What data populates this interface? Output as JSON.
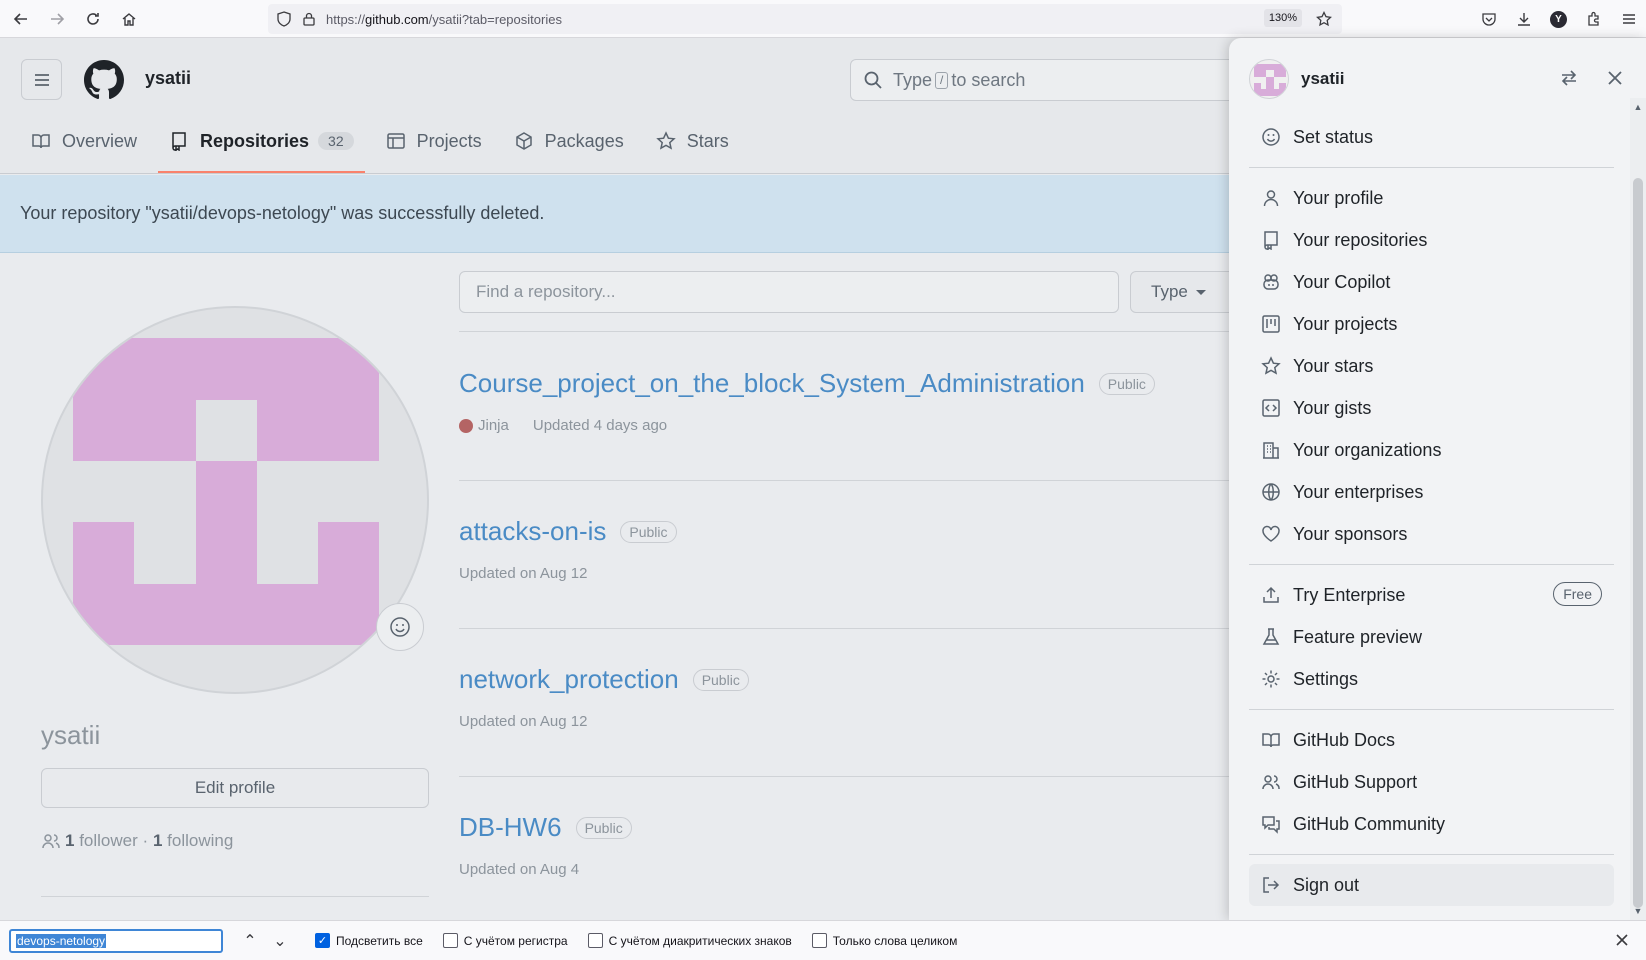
{
  "browser": {
    "url_prefix": "https://",
    "url_host": "github.com",
    "url_path": "/ysatii?tab=repositories",
    "zoom": "130%"
  },
  "header": {
    "username": "ysatii",
    "search_prefix": "Type",
    "search_key": "/",
    "search_suffix": "to search"
  },
  "tabs": [
    {
      "label": "Overview"
    },
    {
      "label": "Repositories",
      "count": "32"
    },
    {
      "label": "Projects"
    },
    {
      "label": "Packages"
    },
    {
      "label": "Stars"
    }
  ],
  "flash": "Your repository \"ysatii/devops-netology\" was successfully deleted.",
  "profile": {
    "name": "ysatii",
    "edit_label": "Edit profile",
    "followers_count": "1",
    "followers_word": "follower",
    "dot": "·",
    "following_count": "1",
    "following_word": "following"
  },
  "repo_filter": {
    "placeholder": "Find a repository...",
    "type_label": "Type"
  },
  "repos": [
    {
      "name": "Course_project_on_the_block_System_Administration",
      "visibility": "Public",
      "language": "Jinja",
      "updated": "Updated 4 days ago"
    },
    {
      "name": "attacks-on-is",
      "visibility": "Public",
      "updated": "Updated on Aug 12"
    },
    {
      "name": "network_protection",
      "visibility": "Public",
      "updated": "Updated on Aug 12"
    },
    {
      "name": "DB-HW6",
      "visibility": "Public",
      "updated": "Updated on Aug 4"
    }
  ],
  "menu": {
    "username": "ysatii",
    "items": [
      {
        "label": "Set status"
      },
      {
        "label": "Your profile"
      },
      {
        "label": "Your repositories"
      },
      {
        "label": "Your Copilot"
      },
      {
        "label": "Your projects"
      },
      {
        "label": "Your stars"
      },
      {
        "label": "Your gists"
      },
      {
        "label": "Your organizations"
      },
      {
        "label": "Your enterprises"
      },
      {
        "label": "Your sponsors"
      },
      {
        "label": "Try Enterprise",
        "badge": "Free"
      },
      {
        "label": "Feature preview"
      },
      {
        "label": "Settings"
      },
      {
        "label": "GitHub Docs"
      },
      {
        "label": "GitHub Support"
      },
      {
        "label": "GitHub Community"
      },
      {
        "label": "Sign out"
      }
    ]
  },
  "findbar": {
    "query": "devops-netology",
    "highlight_all": "Подсветить все",
    "match_case": "С учётом регистра",
    "diacritics": "С учётом диакритических знаков",
    "whole_words": "Только слова целиком"
  },
  "colors": {
    "link": "#4a8bc5",
    "avatar_pink": "#d8acd9",
    "tab_underline": "#f9826c",
    "jinja_dot": "#b46464"
  }
}
